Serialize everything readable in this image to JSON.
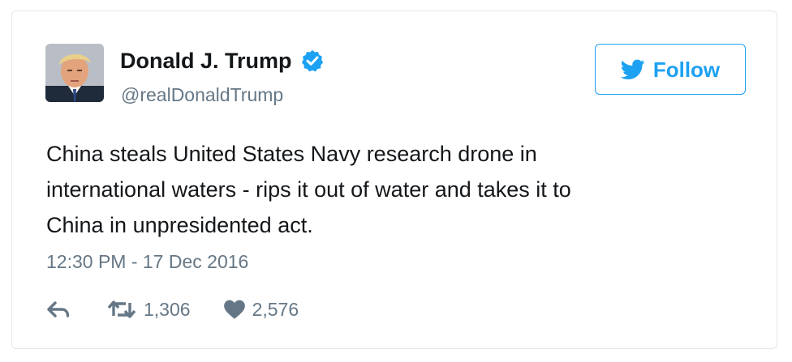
{
  "user": {
    "name": "Donald J. Trump",
    "handle": "@realDonaldTrump",
    "avatar_icon": "profile-photo",
    "verified_icon": "verified-badge-icon"
  },
  "follow_button": {
    "label": "Follow",
    "icon": "twitter-bird-icon"
  },
  "tweet": {
    "lines": [
      "China steals United States Navy research drone in",
      "international waters - rips it out of water and takes it to",
      "China in unpresidented act."
    ],
    "timestamp": "12:30 PM - 17 Dec 2016"
  },
  "actions": {
    "reply_icon": "reply-icon",
    "retweet_icon": "retweet-icon",
    "retweet_count": "1,306",
    "like_icon": "heart-icon",
    "like_count": "2,576"
  },
  "colors": {
    "accent": "#1da1f2",
    "verified": "#1da1f2",
    "text": "#14171a",
    "muted": "#657786",
    "border": "#e1e8ed"
  }
}
